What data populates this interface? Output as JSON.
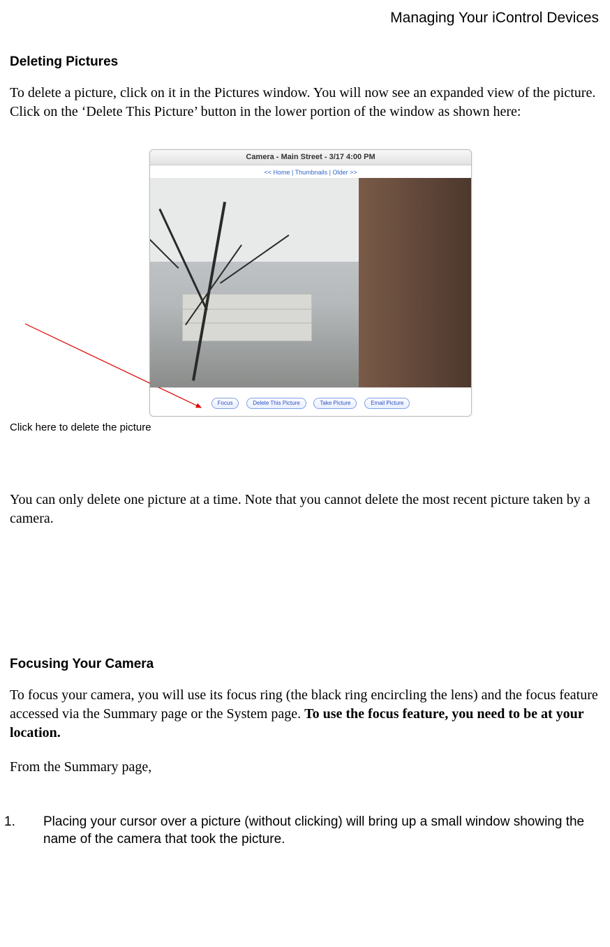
{
  "header": {
    "title": "Managing Your iControl Devices"
  },
  "section1": {
    "heading": "Deleting Pictures",
    "para1": "To delete a picture, click on it in the Pictures window. You will now see an expanded view of the picture. Click on the ‘Delete This Picture’ button in the lower portion of the window as shown here:",
    "figure": {
      "caption": "Click here to delete the picture",
      "window_title": "Camera - Main Street - 3/17 4:00 PM",
      "nav_text": "<< Home | Thumbnails | Older >>",
      "buttons": {
        "focus": "Focus",
        "delete": "Delete This Picture",
        "take": "Take Picture",
        "email": "Email Picture"
      }
    },
    "para2": "You can only delete one picture at a time. Note that you cannot delete the most recent picture taken by a camera."
  },
  "section2": {
    "heading": "Focusing Your Camera",
    "para1_pre": "To focus your camera, you will use its focus ring (the black ring encircling the lens) and the focus feature accessed via the Summary page or the System page. ",
    "para1_bold": "To use the focus feature, you need to be at your location.",
    "para2": "From the Summary page,",
    "list": {
      "item1_num": "1.",
      "item1_text": "Placing your cursor over a picture (without clicking) will bring up a small window showing the name of the camera that took the picture."
    }
  }
}
